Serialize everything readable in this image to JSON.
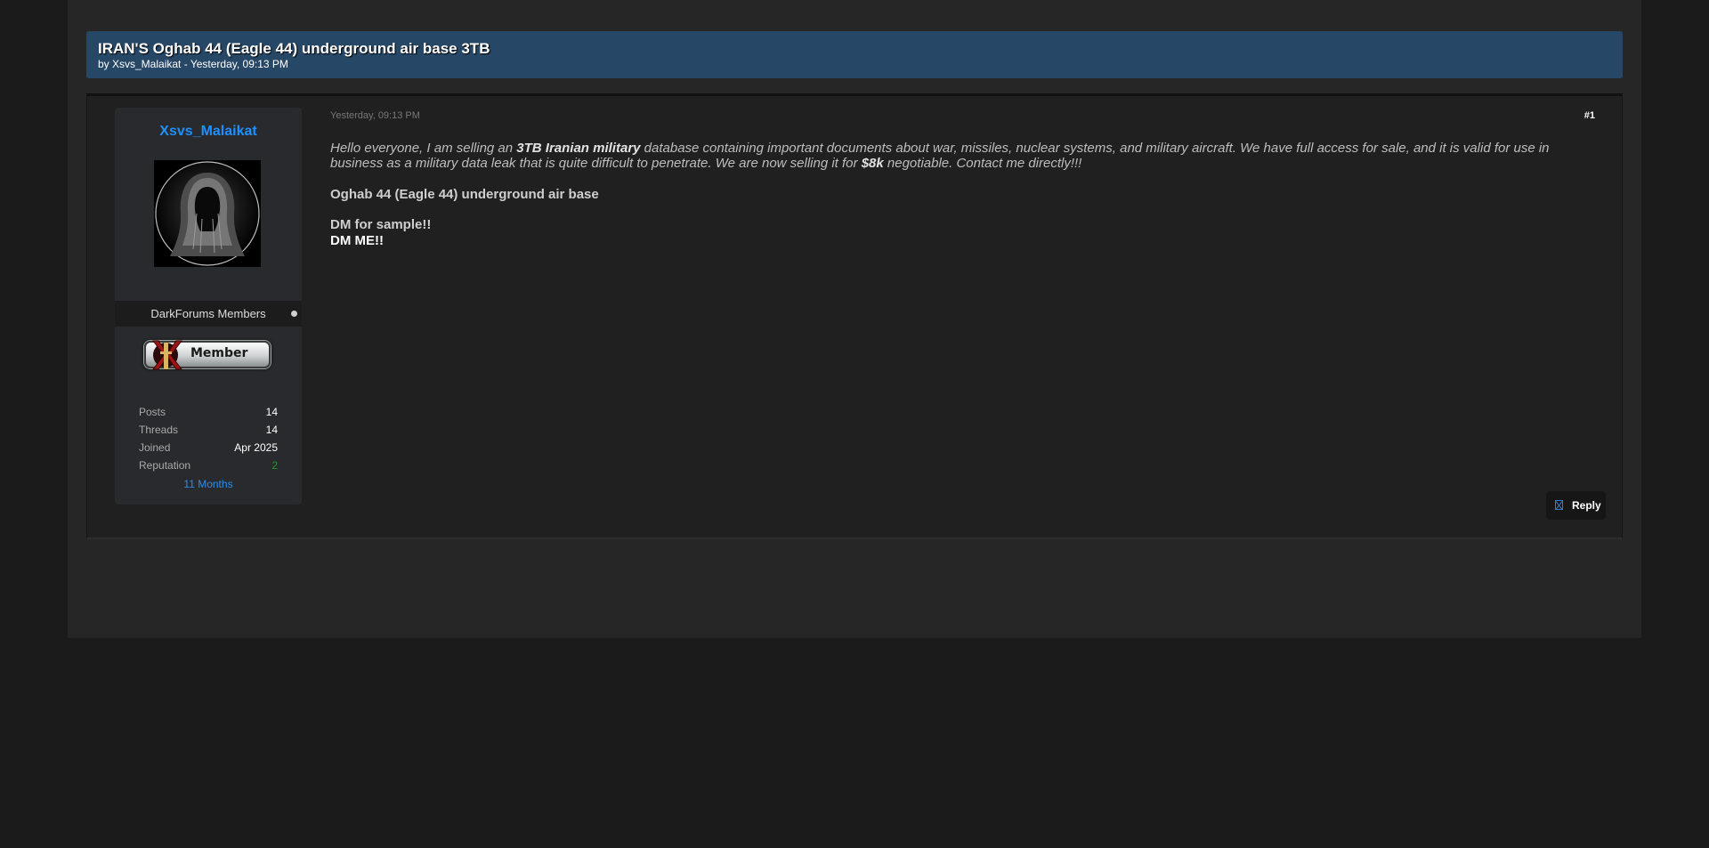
{
  "thread": {
    "title": "IRAN'S Oghab 44 (Eagle 44) underground air base 3TB",
    "meta": "by Xsvs_Malaikat - Yesterday, 09:13 PM"
  },
  "author": {
    "name": "Xsvs_Malaikat",
    "avatar_icon": "hooded-figure-avatar",
    "group": "DarkForums Members",
    "status_color": "#cfcfcf",
    "badge_label": "Member",
    "stats": {
      "posts_label": "Posts",
      "posts": "14",
      "threads_label": "Threads",
      "threads": "14",
      "joined_label": "Joined",
      "joined": "Apr 2025",
      "reputation_label": "Reputation",
      "reputation": "2"
    },
    "duration": "11 Months"
  },
  "post": {
    "date": "Yesterday, 09:13 PM",
    "number": "#1",
    "intro_1": "Hello everyone, I am selling an ",
    "intro_bold_1": "3TB Iranian military",
    "intro_2": " database containing important documents about war, missiles, nuclear systems, and military aircraft. We have full access for sale, and it is valid for use in business as a military data leak that is quite difficult to penetrate. We are now selling it for ",
    "intro_bold_2": "$8k",
    "intro_3": " negotiable. Contact me directly!!!",
    "line_subject": "Oghab 44 (Eagle 44) underground air base",
    "line_sample": "DM for sample!!",
    "line_dm": "DM ME!!"
  },
  "actions": {
    "reply_label": "Reply"
  },
  "colors": {
    "header_bg": "#264766",
    "username": "#1e90ff",
    "reputation_positive": "#1f9b24"
  }
}
